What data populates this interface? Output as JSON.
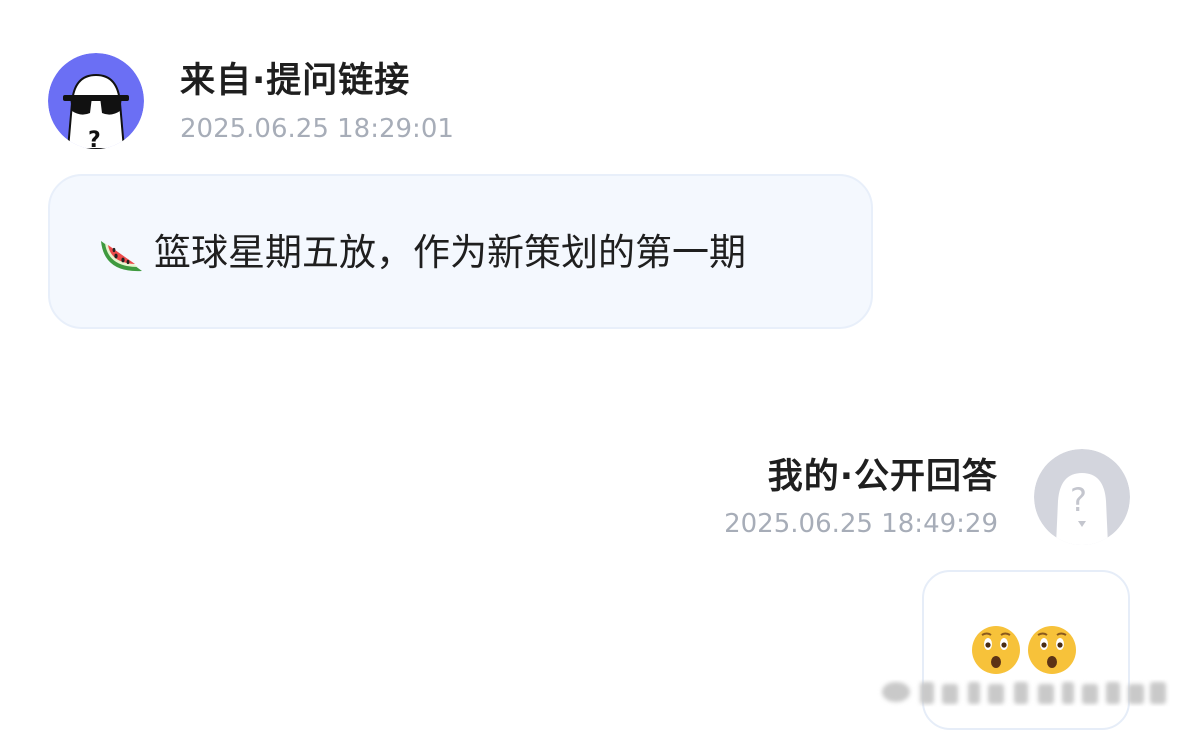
{
  "question": {
    "avatar_icon": "sunglasses-ghost-avatar-icon",
    "sender": "来自·提问链接",
    "time": "2025.06.25 18:29:01",
    "emoji": "watermelon-icon",
    "text": "篮球星期五放，作为新策划的第一期"
  },
  "answer": {
    "avatar_icon": "question-mark-ghost-avatar-icon",
    "sender": "我的·公开回答",
    "time": "2025.06.25 18:49:29",
    "emojis": [
      "astonished-face-icon",
      "astonished-face-icon"
    ]
  },
  "colors": {
    "asker_avatar_bg": "#6b6ff4",
    "answer_avatar_bg": "#d3d5dd",
    "bubble_bg": "#f4f8fe",
    "time_text": "#a7adb8"
  }
}
